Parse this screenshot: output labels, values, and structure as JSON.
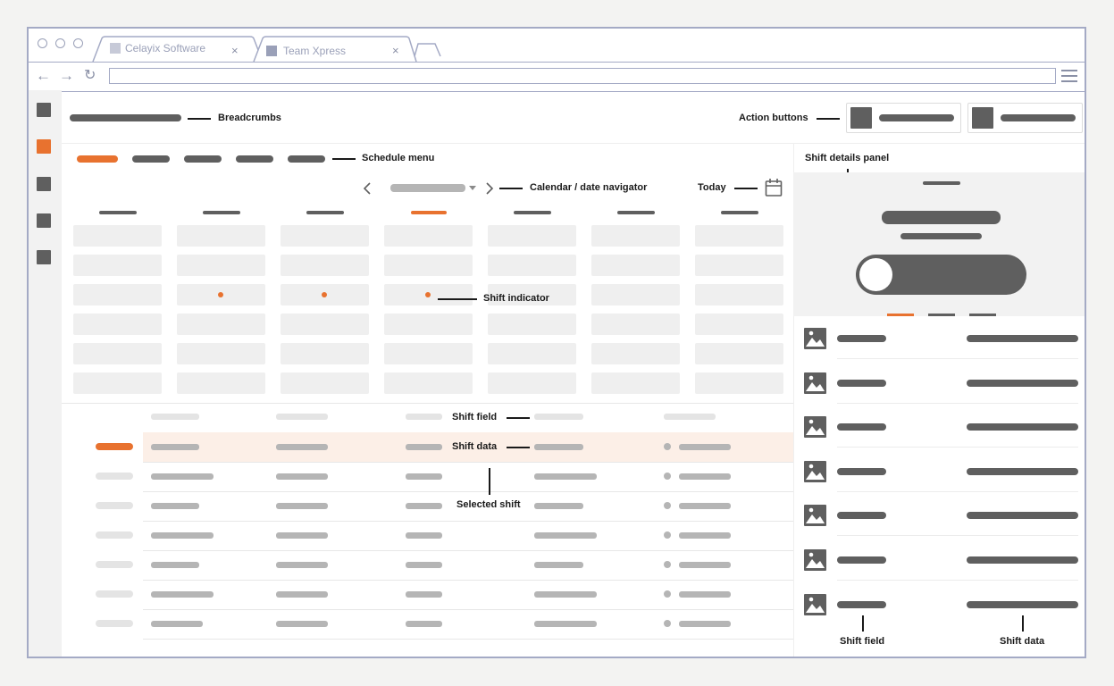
{
  "browser": {
    "tabs": [
      {
        "label": "Celayix Software",
        "close": "×"
      },
      {
        "label": "Team Xpress",
        "close": "×"
      }
    ],
    "address": ""
  },
  "colors": {
    "accent": "#e8722f",
    "dark": "#5f5f5f",
    "placeholder": "#b5b5b5",
    "cell": "#efefef",
    "frame": "#a4aac5",
    "selected_row": "#fcefe7"
  },
  "icons": [
    "back-arrow-icon",
    "forward-arrow-icon",
    "reload-icon",
    "hamburger-menu-icon",
    "calendar-icon",
    "image-icon",
    "chevron-left-icon",
    "chevron-right-icon",
    "caret-down-icon"
  ],
  "annotations": {
    "breadcrumbs": "Breadcrumbs",
    "action_buttons": "Action buttons",
    "schedule_menu": "Schedule menu",
    "shift_details_panel": "Shift details panel",
    "calendar_navigator": "Calendar / date navigator",
    "today": "Today",
    "shift_indicator": "Shift indicator",
    "shift_field": "Shift field",
    "shift_data": "Shift data",
    "selected_shift": "Selected shift",
    "panel_shift_field": "Shift field",
    "panel_shift_data": "Shift data"
  },
  "sidebar": {
    "active_index": 1,
    "item_count": 5
  },
  "schedule_menu": {
    "active_index": 0,
    "item_count": 5
  },
  "calendar": {
    "columns": 7,
    "rows": 6,
    "active_column": 3,
    "shift_indicators": [
      [
        2,
        1
      ],
      [
        2,
        2
      ],
      [
        2,
        3
      ]
    ]
  },
  "shift_list": {
    "rows": 7,
    "selected_row": 0
  },
  "details_panel": {
    "toggle_on": false,
    "tab_active_index": 0,
    "field_rows": 7
  }
}
